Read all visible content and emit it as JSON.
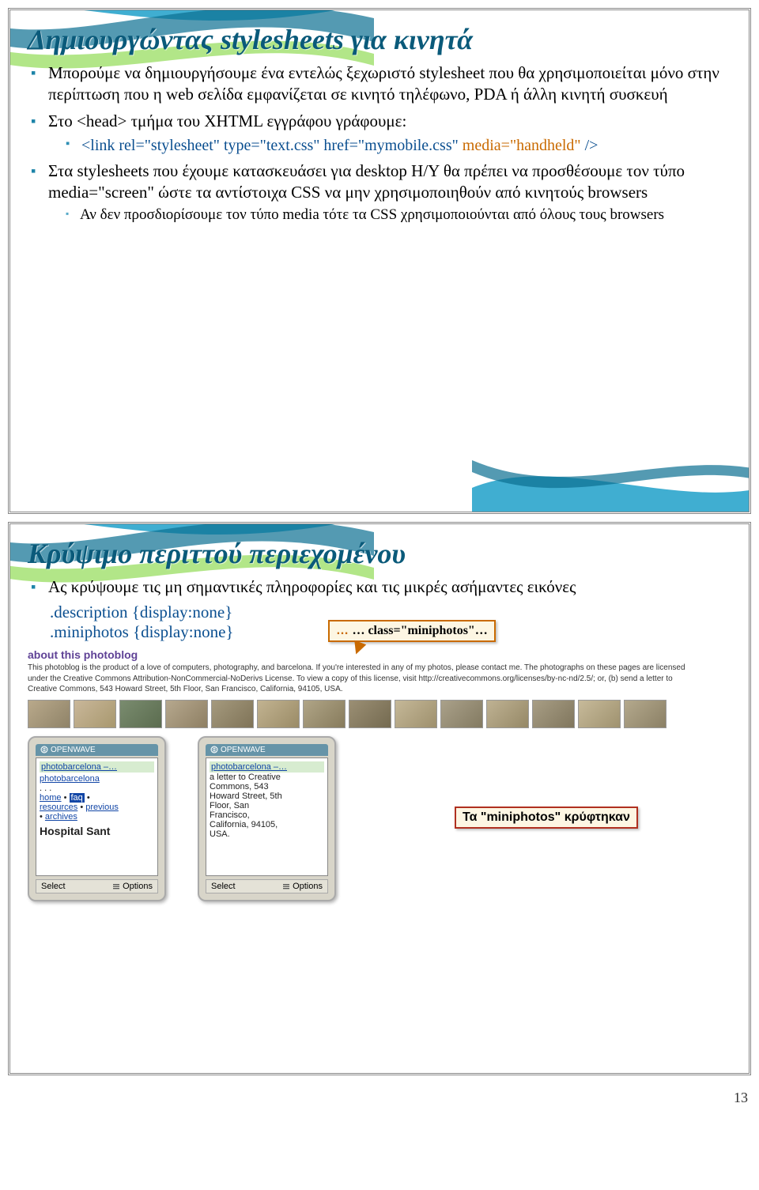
{
  "page_number": "13",
  "slide1": {
    "title": "Δημιουργώντας stylesheets για κινητά",
    "b1": "Μπορούμε να δημιουργήσουμε ένα εντελώς ξεχωριστό stylesheet που θα χρησιμοποιείται μόνο στην περίπτωση που η web σελίδα εμφανίζεται σε κινητό τηλέφωνο, PDA ή άλλη κινητή συσκευή",
    "b2": "Στο <head> τμήμα του XHTML εγγράφου γράφουμε:",
    "code1a": "<link rel=\"stylesheet\" type=\"text.css\" href=\"mymobile.css\"",
    "code1b": "media=\"handheld\"",
    "code1c": " />",
    "b3": "Στα stylesheets που έχουμε κατασκευάσει για desktop Η/Υ θα πρέπει να προσθέσουμε τον τύπο media=\"screen\" ώστε τα αντίστοιχα CSS να μην χρησιμοποιηθούν από κινητούς browsers",
    "b3s1": "Αν δεν προσδιορίσουμε τον τύπο media τότε τα CSS χρησιμοποιούνται από όλους τους browsers"
  },
  "slide2": {
    "title": "Κρύψιμο περιττού περιεχομένου",
    "b1": "Ας κρύψουμε τις μη σημαντικές πληροφορίες και τις μικρές ασήμαντες εικόνες",
    "css1": ".description {display:none}",
    "css2": ".miniphotos {display:none}",
    "callout1": "… class=\"miniphotos\"…",
    "callout2": "Τα \"miniphotos\" κρύφτηκαν",
    "about_hdr": "about this photoblog",
    "about_text": "This photoblog is the product of a love of computers, photography, and barcelona. If you're interested in any of my photos, please contact me. The photographs on these pages are licensed under the Creative Commons Attribution-NonCommercial-NoDerivs License. To view a copy of this license, visit http://creativecommons.org/licenses/by-nc-nd/2.5/; or, (b) send a letter to Creative Commons, 543 Howard Street, 5th Floor, San Francisco, California, 94105, USA.",
    "phone_brand": "OPENWAVE",
    "phone1": {
      "title": "photobarcelona –…",
      "line": "photobarcelona",
      "ell": ". . .",
      "nav1": "home",
      "nav1b": "faq",
      "nav2": "resources",
      "nav3": "previous",
      "nav4": "archives",
      "big": "Hospital Sant"
    },
    "phone2": {
      "title": "photobarcelona –…",
      "l1": "a letter to Creative",
      "l2": "Commons, 543",
      "l3": "Howard Street, 5th",
      "l4": "Floor, San",
      "l5": "Francisco,",
      "l6": "California, 94105,",
      "l7": "USA."
    },
    "soft_select": "Select",
    "soft_options": "Options"
  }
}
